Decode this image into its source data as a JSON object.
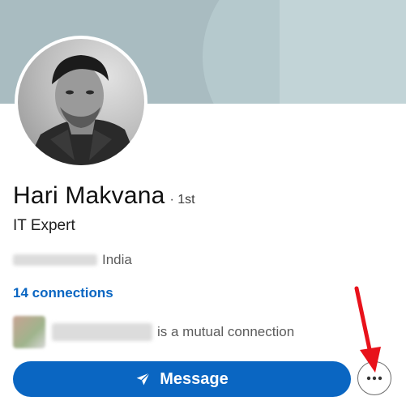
{
  "profile": {
    "name": "Hari Makvana",
    "degree": "· 1st",
    "headline": "IT Expert",
    "location": "India",
    "connections": "14 connections",
    "mutual_text": "is a mutual connection"
  },
  "actions": {
    "message_label": "Message",
    "more_icon": "ellipsis-icon"
  },
  "colors": {
    "brand_blue": "#0a66c2",
    "annotation_red": "#e8121b"
  }
}
